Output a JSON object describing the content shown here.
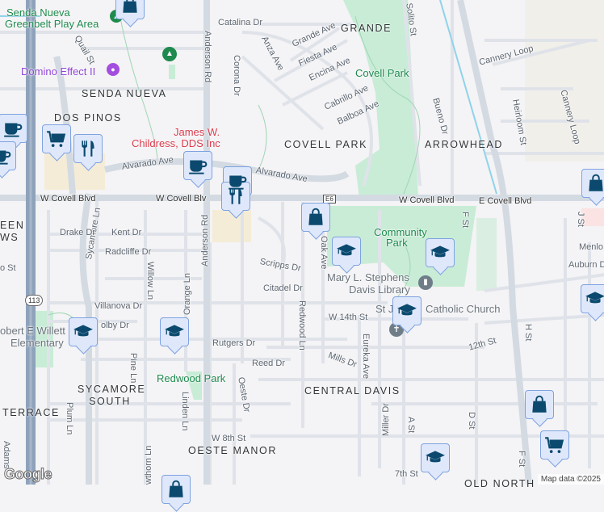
{
  "map": {
    "neighborhoods": [
      "SENDA NUEVA",
      "DOS PINOS",
      "GRANDE",
      "COVELL PARK",
      "ARROWHEAD",
      "CENTRAL DAVIS",
      "SYCAMORE SOUTH",
      "TERRACE",
      "OESTE MANOR",
      "OLD NORTH",
      "EEN",
      "WS"
    ],
    "parks": [
      "Senda Nueva",
      "Greenbelt Play Area",
      "Covell Park",
      "Community",
      "Park",
      "Redwood Park"
    ],
    "pois": {
      "domino": "Domino Effect II",
      "dentist_1": "James W.",
      "dentist_2": "Childress, DDS Inc",
      "library_1": "Mary L. Stephens",
      "library_2": "Davis Library",
      "church_a": "St J",
      "church_b": "Catholic Church",
      "school_1": "obert E Willett",
      "school_2": "Elementary"
    },
    "streets": [
      "Catalina Dr",
      "Quail St",
      "Anderson Rd",
      "Corona Dr",
      "Anza Ave",
      "Grande Ave",
      "Fiesta Ave",
      "Encina Ave",
      "Solito St",
      "Cabrillo Ave",
      "Balboa Ave",
      "Bueno Dr",
      "Cannery Loop",
      "Heirloom St",
      "Cannery Loop",
      "Alvarado Ave",
      "Alvarado Ave",
      "W Covell Blvd",
      "W Covell Blv",
      "W Covell Blvd",
      "E Covell Blvd",
      "F St",
      "J St",
      "Sycamore Ln",
      "Drake Dr",
      "Kent Dr",
      "Anderson Rd",
      "Radcliffe Dr",
      "Willow Ln",
      "Scripps Dr",
      "Citadel Dr",
      "Orange Ln",
      "Villanova Dr",
      "olby Dr",
      "Rutgers Dr",
      "Reed Dr",
      "Redwood Ln",
      "Oak Ave",
      "W 14th St",
      "Eureka Ave",
      "Mills Dr",
      "12th St",
      "H St",
      "Miller Dr",
      "A St",
      "D St",
      "Menlo",
      "Auburn D",
      "Oeste Dr",
      "Plum Ln",
      "Linden Ln",
      "Pine Ln",
      "W 8th St",
      "wthorn Ln",
      "Adams",
      "7th St",
      "F St",
      "o St"
    ],
    "route_shields": {
      "e6": "E6",
      "ca113": "113"
    },
    "credit": "Map data ©2025",
    "logo": "Google"
  },
  "pins": [
    {
      "type": "shopping-bag"
    },
    {
      "type": "coffee"
    },
    {
      "type": "coffee"
    },
    {
      "type": "shopping-cart"
    },
    {
      "type": "restaurant"
    },
    {
      "type": "coffee"
    },
    {
      "type": "coffee"
    },
    {
      "type": "restaurant"
    },
    {
      "type": "shopping-bag"
    },
    {
      "type": "school"
    },
    {
      "type": "school"
    },
    {
      "type": "school"
    },
    {
      "type": "school"
    },
    {
      "type": "school"
    },
    {
      "type": "school"
    },
    {
      "type": "shopping-bag"
    },
    {
      "type": "shopping-bag"
    },
    {
      "type": "shopping-cart"
    },
    {
      "type": "school"
    },
    {
      "type": "shopping-bag"
    }
  ],
  "colors": {
    "park": "#c8ecd6",
    "road": "#d5dce4",
    "highway": "#8fa3bd",
    "pin_icon": "#0b4a6e",
    "commercial": "#f5ecd7"
  }
}
